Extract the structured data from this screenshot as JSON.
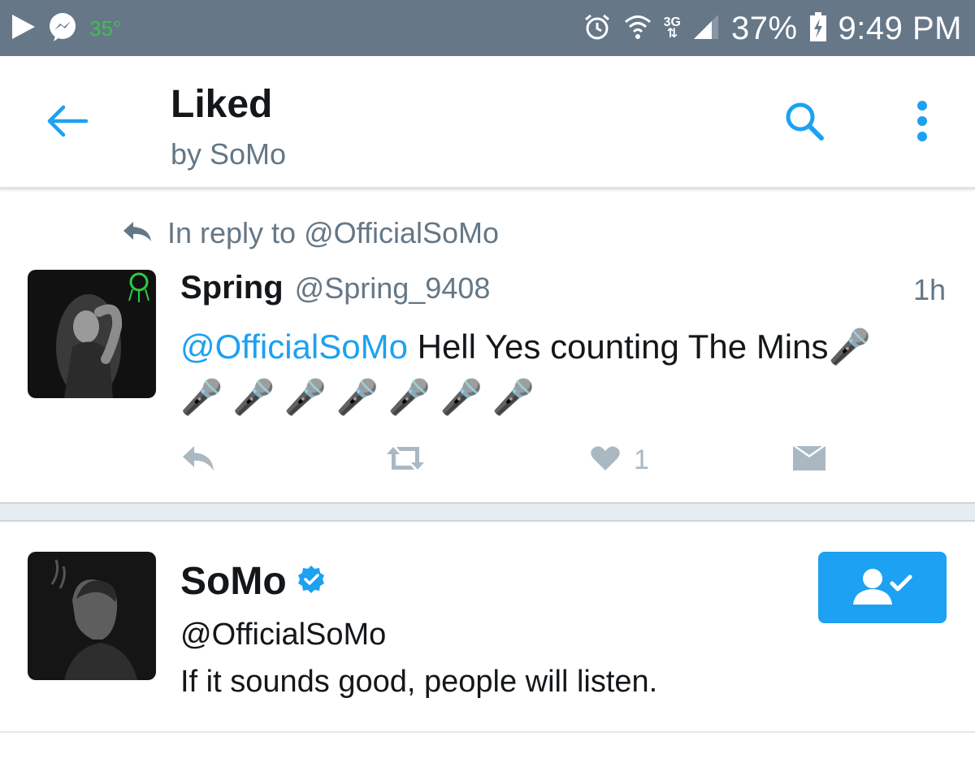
{
  "status_bar": {
    "temperature": "35°",
    "battery": "37%",
    "time": "9:49 PM",
    "network": "3G",
    "icons": [
      "play-store-icon",
      "messenger-icon",
      "alarm-icon",
      "wifi-icon",
      "signal-icon",
      "battery-charging-icon"
    ]
  },
  "toolbar": {
    "title": "Liked",
    "subtitle": "by SoMo",
    "back_icon": "arrow-left-icon",
    "search_icon": "search-icon",
    "more_icon": "more-vertical-icon",
    "accent_color": "#1da1f2"
  },
  "tweet": {
    "reply_context": "In reply to @OfficialSoMo",
    "display_name": "Spring",
    "handle": "@Spring_9408",
    "time": "1h",
    "mention": "@OfficialSoMo",
    "text": " Hell Yes counting The Mins🎤",
    "emoji_line": "🎤 🎤 🎤 🎤 🎤 🎤 🎤",
    "like_count": "1",
    "actions": [
      "reply-icon",
      "retweet-icon",
      "heart-icon",
      "direct-message-icon"
    ]
  },
  "user_card": {
    "name": "SoMo",
    "verified": true,
    "handle": "@OfficialSoMo",
    "bio": "If it sounds good, people will listen.",
    "follow_state": "following",
    "follow_icon": "following-user-icon"
  }
}
